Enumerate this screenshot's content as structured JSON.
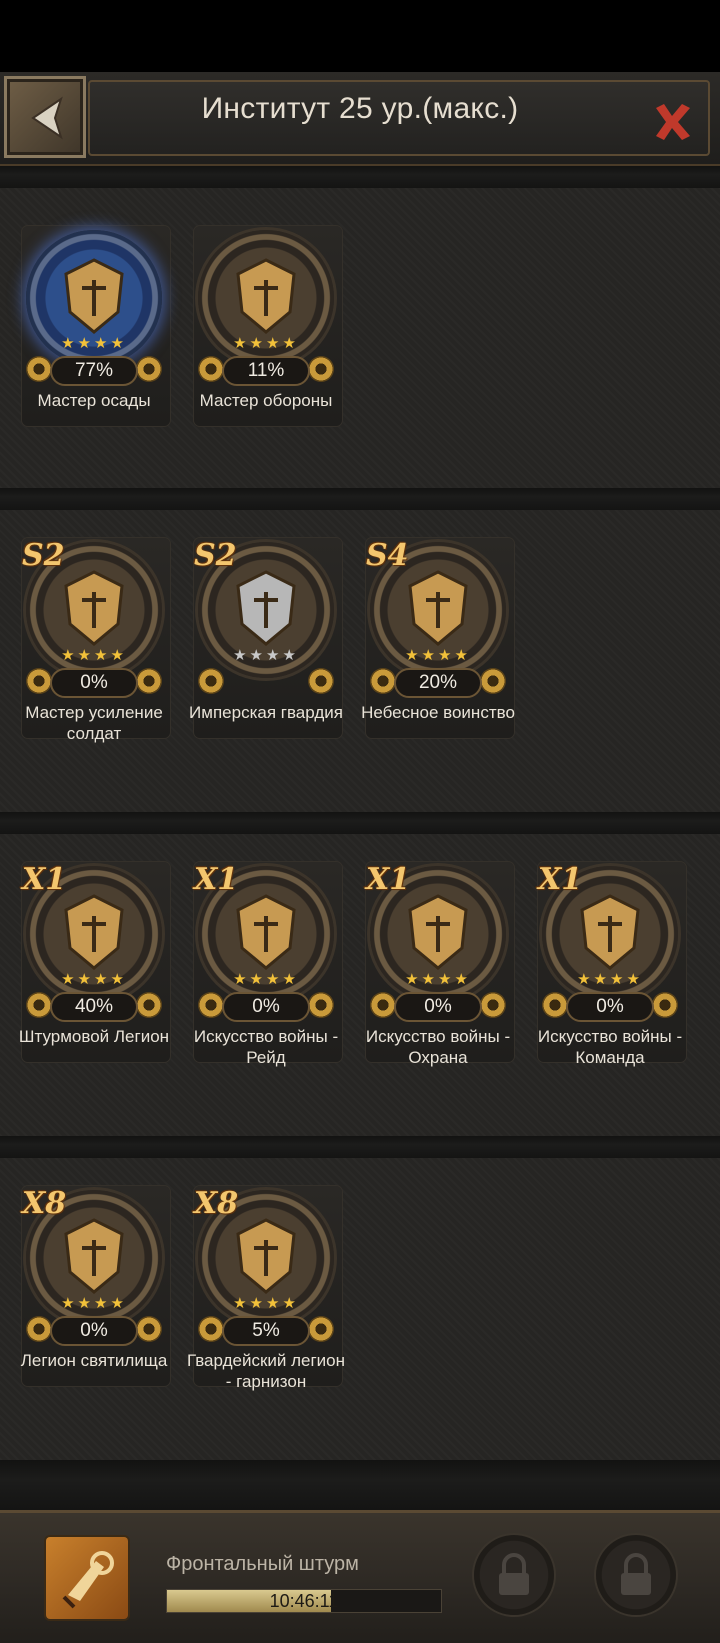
{
  "header": {
    "title": "Институт 25 ур.(макс.)",
    "back_icon": "arrow-left-icon",
    "close_icon": "close-icon",
    "accent_color": "#c0392b"
  },
  "sections": [
    {
      "skills": [
        {
          "name": "Мастер осады",
          "percent": "77%",
          "progress": 0.77,
          "stars_filled": 4,
          "stars_total": 4,
          "grade": "",
          "emblem": "knight-chess-icon",
          "ring": "blue"
        },
        {
          "name": "Мастер обороны",
          "percent": "11%",
          "progress": 0.11,
          "stars_filled": 4,
          "stars_total": 4,
          "grade": "",
          "emblem": "tower-icon",
          "ring": "bronze"
        }
      ]
    },
    {
      "skills": [
        {
          "name": "Мастер усиление солдат",
          "percent": "0%",
          "progress": 0,
          "stars_filled": 4,
          "stars_total": 4,
          "grade": "S2",
          "emblem": "gauntlet-icon",
          "ring": "bronze"
        },
        {
          "name": "Имперская гвардия",
          "percent": "",
          "progress": 0,
          "stars_filled": 0,
          "stars_total": 4,
          "grade": "S2",
          "emblem": "knight-helmet-icon",
          "ring": "silver"
        },
        {
          "name": "Небесное воинство",
          "percent": "20%",
          "progress": 0.2,
          "stars_filled": 4,
          "stars_total": 4,
          "grade": "S4",
          "emblem": "crusader-helmet-icon",
          "ring": "bronze"
        }
      ]
    },
    {
      "skills": [
        {
          "name": "Штурмовой Легион",
          "percent": "40%",
          "progress": 0.4,
          "stars_filled": 4,
          "stars_total": 4,
          "grade": "X1",
          "emblem": "lion-icon",
          "ring": "bronze"
        },
        {
          "name": "Искусство войны - Рейд",
          "percent": "0%",
          "progress": 0,
          "stars_filled": 4,
          "stars_total": 4,
          "grade": "X1",
          "emblem": "crossed-swords-icon",
          "ring": "bronze"
        },
        {
          "name": "Искусство войны - Охрана",
          "percent": "0%",
          "progress": 0,
          "stars_filled": 4,
          "stars_total": 4,
          "grade": "X1",
          "emblem": "crossed-axes-icon",
          "ring": "bronze"
        },
        {
          "name": "Искусство войны - Команда",
          "percent": "0%",
          "progress": 0,
          "stars_filled": 4,
          "stars_total": 4,
          "grade": "X1",
          "emblem": "war-horns-icon",
          "ring": "bronze"
        }
      ]
    },
    {
      "skills": [
        {
          "name": "Легион святилища",
          "percent": "0%",
          "progress": 0,
          "stars_filled": 4,
          "stars_total": 4,
          "grade": "X8",
          "emblem": "plumed-helmet-icon",
          "ring": "bronze"
        },
        {
          "name": "Гвардейский легион - гарнизон",
          "percent": "5%",
          "progress": 0.05,
          "stars_filled": 4,
          "stars_total": 4,
          "grade": "X8",
          "emblem": "golden-castle-icon",
          "ring": "bronze"
        }
      ]
    }
  ],
  "bottom_bar": {
    "current_research_label": "Фронтальный штурм",
    "current_research_icon": "horn-icon",
    "timer": "10:46:11",
    "progress": 0.6,
    "locked_slots": [
      "lock-icon",
      "lock-icon"
    ]
  }
}
